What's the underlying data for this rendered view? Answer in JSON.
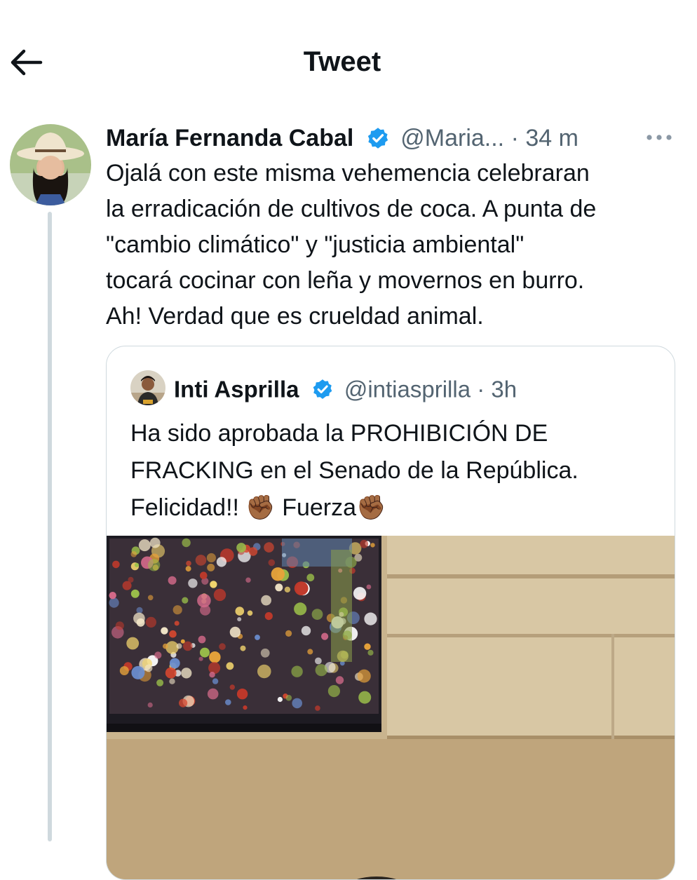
{
  "header": {
    "title": "Tweet",
    "back_icon": "arrow-left-icon"
  },
  "tweet": {
    "author_name": "María Fernanda Cabal",
    "handle": "@Maria...",
    "separator": "·",
    "time": "34 m",
    "verified_icon": "verified-badge-icon",
    "more_icon": "more-horizontal-icon",
    "text": "Ojalá con este misma vehemencia celebraran\nla erradicación de cultivos de coca. A punta de\n\"cambio climático\" y \"justicia ambiental\"\ntocará cocinar con leña y movernos en burro.\nAh! Verdad que es crueldad animal."
  },
  "quote": {
    "author_name": "Inti Asprilla",
    "handle": "@intiasprilla",
    "separator": "·",
    "time": "3h",
    "verified_icon": "verified-badge-icon",
    "text_part1": "Ha sido aprobada la PROHIBICIÓN DE\nFRACKING en el Senado de la República.\nFelicidad!! ",
    "emoji1": "✊🏾",
    "text_part2": " Fuerza",
    "emoji2": "✊🏾"
  },
  "colors": {
    "verified": "#1d9bf0",
    "secondary_text": "#536471",
    "border": "#cfd9de",
    "thread_line": "#cfd9de"
  }
}
